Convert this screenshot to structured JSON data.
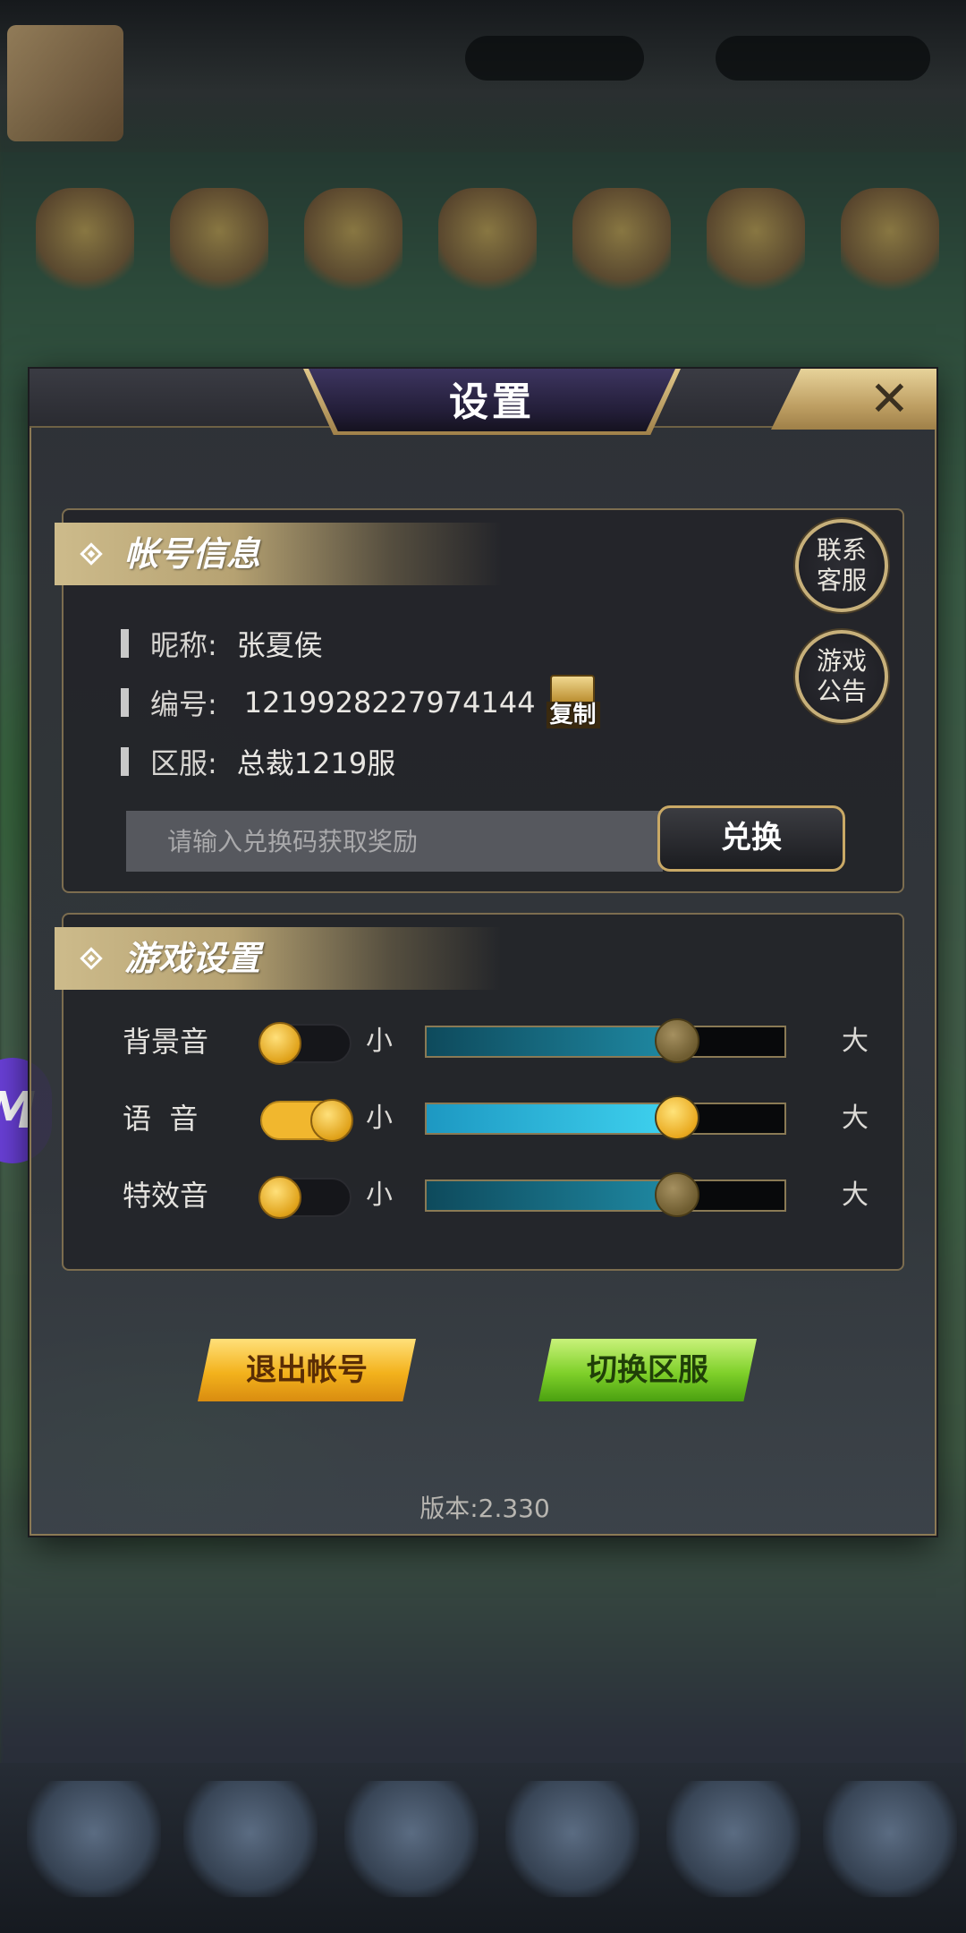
{
  "dialog": {
    "title": "设置",
    "close_label": "✕"
  },
  "account": {
    "section_title": "帐号信息",
    "nickname_key": "昵称:",
    "nickname_value": "张夏侯",
    "id_key": "编号:",
    "id_value": "1219928227974144",
    "copy_label": "复制",
    "server_key": "区服:",
    "server_value": "总裁1219服",
    "contact_btn_line1": "联系",
    "contact_btn_line2": "客服",
    "notice_btn_line1": "游戏",
    "notice_btn_line2": "公告",
    "redeem_placeholder": "请输入兑换码获取奖励",
    "redeem_value": "",
    "redeem_button": "兑换"
  },
  "game_settings": {
    "section_title": "游戏设置",
    "small_label": "小",
    "large_label": "大",
    "rows": [
      {
        "label": "背景音",
        "toggle_on": false,
        "volume": 0.7
      },
      {
        "label": "语  音",
        "toggle_on": true,
        "volume": 0.7
      },
      {
        "label": "特效音",
        "toggle_on": false,
        "volume": 0.7
      }
    ]
  },
  "buttons": {
    "logout": "退出帐号",
    "switch_server": "切换区服"
  },
  "version_text": "版本:2.330",
  "floating_badge": "M",
  "icons": [
    "close-icon",
    "diamond-icon",
    "copy-icon",
    "floating-app-icon"
  ],
  "colors": {
    "accent_gold": "#c7b07a",
    "toggle_on": "#f1b72e",
    "slider_fill": "#1f8aa4",
    "logout_button": "#f3b21c",
    "switch_button": "#7fd02a"
  }
}
